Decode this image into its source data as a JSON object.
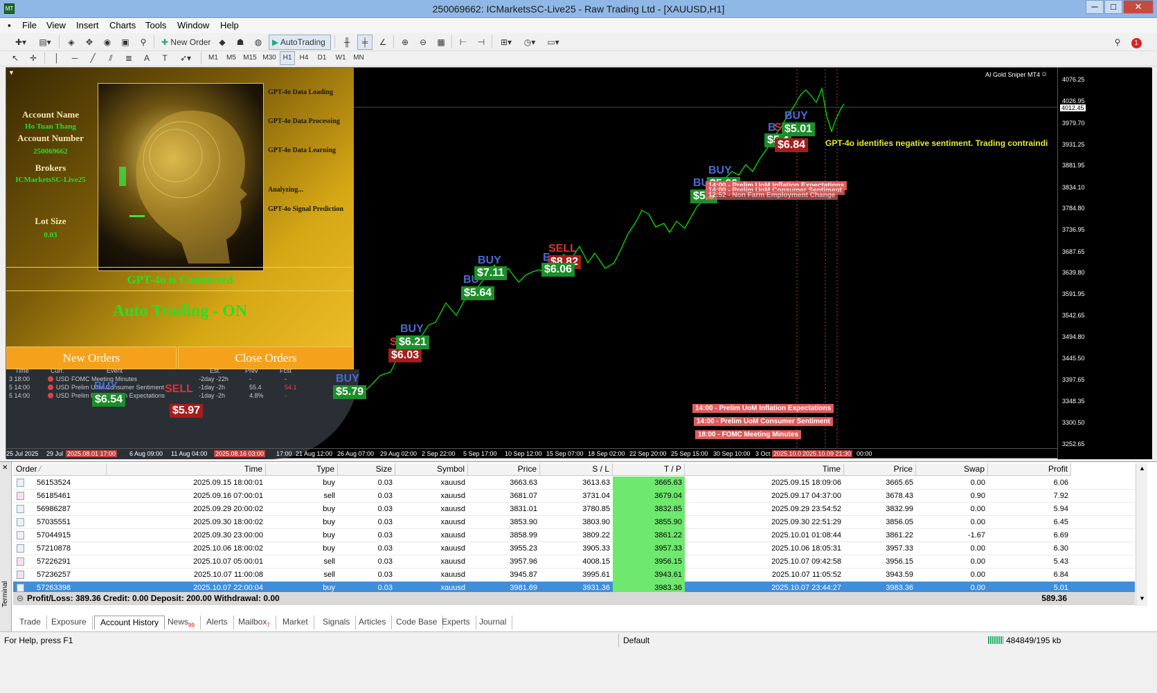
{
  "window": {
    "title": "250069662: ICMarketsSC-Live25 - Raw Trading Ltd - [XAUUSD,H1]"
  },
  "menu": [
    "File",
    "View",
    "Insert",
    "Charts",
    "Tools",
    "Window",
    "Help"
  ],
  "toolbar": {
    "new_order": "New Order",
    "autotrading": "AutoTrading",
    "timeframes": [
      "M1",
      "M5",
      "M15",
      "M30",
      "H1",
      "H4",
      "D1",
      "W1",
      "MN"
    ],
    "active_tf": "H1"
  },
  "notification_count": "1",
  "panel": {
    "account_name_label": "Account Name",
    "account_name": "Ho Tuan Thang",
    "account_number_label": "Account Number",
    "account_number": "250069662",
    "brokers_label": "Brokers",
    "broker": "ICMarketsSC-Live25",
    "lot_size_label": "Lot Size",
    "lot_size": "0.03",
    "steps": [
      "GPT-4o Data Loading",
      "GPT-4o Data Processing",
      "GPT-4o Data Learning",
      "Analyzing...",
      "GPT-4o Signal Prediction"
    ],
    "status": "GPT-4o is Connected",
    "auto_trading": "Auto Trading - ON",
    "new_orders": "New Orders",
    "close_orders": "Close Orders"
  },
  "news": {
    "headers": [
      "Time",
      "Curr.",
      "Event",
      "Est.",
      "Prev",
      "Fcst"
    ],
    "rows": [
      {
        "time": "3 18:00",
        "curr": "USD",
        "event": "FOMC Meeting Minutes",
        "est": "-2day -22h",
        "prev": "-",
        "fcst": "-"
      },
      {
        "time": "5 14:00",
        "curr": "USD",
        "event": "Prelim UoM Consumer Sentiment",
        "est": "-1day -2h",
        "prev": "55.4",
        "fcst": "54.1"
      },
      {
        "time": "5 14:00",
        "curr": "USD",
        "event": "Prelim UoM Inflation Expectations",
        "est": "-1day -2h",
        "prev": "4.8%",
        "fcst": "-"
      }
    ]
  },
  "chart": {
    "indicator": "AI Gold Sniper MT4",
    "sentiment": "GPT-4o identifies negative sentiment. Trading contraindi",
    "current_price": "4012.45",
    "price_ticks": [
      "4076.25",
      "4026.95",
      "3979.70",
      "3931.25",
      "3881.95",
      "3834.10",
      "3784.80",
      "3736.95",
      "3687.65",
      "3639.80",
      "3591.95",
      "3542.65",
      "3494.80",
      "3445.50",
      "3397.65",
      "3348.35",
      "3300.50",
      "3252.65"
    ],
    "time_ticks": [
      "25 Jul 2025",
      "29 Jul",
      "2025.08.01 17:00",
      "6 Aug 09:00",
      "11 Aug 04:00",
      "2025.08.16 03:00",
      "17:00",
      "21 Aug 12:00",
      "26 Aug 07:00",
      "29 Aug 02:00",
      "2 Sep 22:00",
      "5 Sep 17:00",
      "10 Sep 12:00",
      "15 Sep 07:00",
      "18 Sep 02:00",
      "22 Sep 20:00",
      "25 Sep 15:00",
      "30 Sep 10:00",
      "3 Oct",
      "2025.10.0",
      "2025.10.09 21:30",
      "00:00"
    ],
    "signals": [
      {
        "label": "BUY",
        "profit": "$6.54",
        "type": "buy"
      },
      {
        "label": "SELL",
        "profit": "$5.97",
        "type": "sell"
      },
      {
        "label": "BUY",
        "profit": "$5.79",
        "type": "buy"
      },
      {
        "label": "S",
        "profit": "$6.03",
        "type": "sell"
      },
      {
        "label": "BUY",
        "profit": "$6.21",
        "type": "buy"
      },
      {
        "label": "BU",
        "profit": "$5.64",
        "type": "buy"
      },
      {
        "label": "BUY",
        "profit": "$7.11",
        "type": "buy"
      },
      {
        "label": "SELL",
        "profit": "$8.82",
        "type": "sell"
      },
      {
        "label": "E",
        "profit": "$6.06",
        "type": "buy"
      },
      {
        "label": "BU",
        "profit": "$5.9",
        "type": "buy"
      },
      {
        "label": "BUY",
        "profit": "$5.66",
        "type": "buy"
      },
      {
        "label": "B",
        "profit": "$5.4",
        "type": "buy"
      },
      {
        "label": "SE",
        "profit": "$6.84",
        "type": "sell"
      },
      {
        "label": "BUY",
        "profit": "$5.01",
        "type": "buy"
      }
    ],
    "events": [
      "14:00 - Prelim UoM Inflation Expectations",
      "14:00 - Prelim UoM Consumer Sentiment",
      "18:00 - FOMC Meeting Minutes"
    ],
    "events_top": [
      "14:00 - Prelim UoM Inflation Expectations",
      "14:00 - Prelim UoM Consumer Sentiment",
      "12:52 - Non Farm Employment Change"
    ]
  },
  "terminal": {
    "side_label": "Terminal",
    "columns": [
      "Order",
      "Time",
      "Type",
      "Size",
      "Symbol",
      "Price",
      "S / L",
      "T / P",
      "Time",
      "Price",
      "Swap",
      "Profit"
    ],
    "rows": [
      [
        "56153524",
        "2025.09.15 18:00:01",
        "buy",
        "0.03",
        "xauusd",
        "3663.63",
        "3613.63",
        "3665.63",
        "2025.09.15 18:09:06",
        "3665.65",
        "0.00",
        "6.06"
      ],
      [
        "56185461",
        "2025.09.16 07:00:01",
        "sell",
        "0.03",
        "xauusd",
        "3681.07",
        "3731.04",
        "3679.04",
        "2025.09.17 04:37:00",
        "3678.43",
        "0.90",
        "7.92"
      ],
      [
        "56986287",
        "2025.09.29 20:00:02",
        "buy",
        "0.03",
        "xauusd",
        "3831.01",
        "3780.85",
        "3832.85",
        "2025.09.29 23:54:52",
        "3832.99",
        "0.00",
        "5.94"
      ],
      [
        "57035551",
        "2025.09.30 18:00:02",
        "buy",
        "0.03",
        "xauusd",
        "3853.90",
        "3803.90",
        "3855.90",
        "2025.09.30 22:51:29",
        "3856.05",
        "0.00",
        "6.45"
      ],
      [
        "57044915",
        "2025.09.30 23:00:00",
        "buy",
        "0.03",
        "xauusd",
        "3858.99",
        "3809.22",
        "3861.22",
        "2025.10.01 01:08:44",
        "3861.22",
        "-1.67",
        "6.69"
      ],
      [
        "57210878",
        "2025.10.06 18:00:02",
        "buy",
        "0.03",
        "xauusd",
        "3955.23",
        "3905.33",
        "3957.33",
        "2025.10.06 18:05:31",
        "3957.33",
        "0.00",
        "6.30"
      ],
      [
        "57226291",
        "2025.10.07 05:00:01",
        "sell",
        "0.03",
        "xauusd",
        "3957.96",
        "4008.15",
        "3956.15",
        "2025.10.07 09:42:58",
        "3956.15",
        "0.00",
        "5.43"
      ],
      [
        "57236257",
        "2025.10.07 11:00:08",
        "sell",
        "0.03",
        "xauusd",
        "3945.87",
        "3995.61",
        "3943.61",
        "2025.10.07 11:05:52",
        "3943.59",
        "0.00",
        "6.84"
      ],
      [
        "57263398",
        "2025.10.07 22:00:04",
        "buy",
        "0.03",
        "xauusd",
        "3981.69",
        "3931.36",
        "3983.36",
        "2025.10.07 23:44:27",
        "3983.36",
        "0.00",
        "5.01"
      ]
    ],
    "summary": "Profit/Loss: 389.36  Credit: 0.00  Deposit: 200.00  Withdrawal: 0.00",
    "summary_total": "589.36",
    "tabs": [
      {
        "label": "Trade"
      },
      {
        "label": "Exposure"
      },
      {
        "label": "Account History",
        "active": true
      },
      {
        "label": "News",
        "badge": "99"
      },
      {
        "label": "Alerts"
      },
      {
        "label": "Mailbox",
        "badge": "7"
      },
      {
        "label": "Market"
      },
      {
        "label": "Signals"
      },
      {
        "label": "Articles"
      },
      {
        "label": "Code Base"
      },
      {
        "label": "Experts"
      },
      {
        "label": "Journal"
      }
    ]
  },
  "status": {
    "help": "For Help, press F1",
    "profile": "Default",
    "traffic": "484849/195 kb"
  },
  "colors": {
    "buy": "#1b8f2a",
    "sell": "#a51d1d",
    "tp_cell": "#6ee86e",
    "selected_row": "#3f8ddb",
    "price_line": "#00e000"
  }
}
